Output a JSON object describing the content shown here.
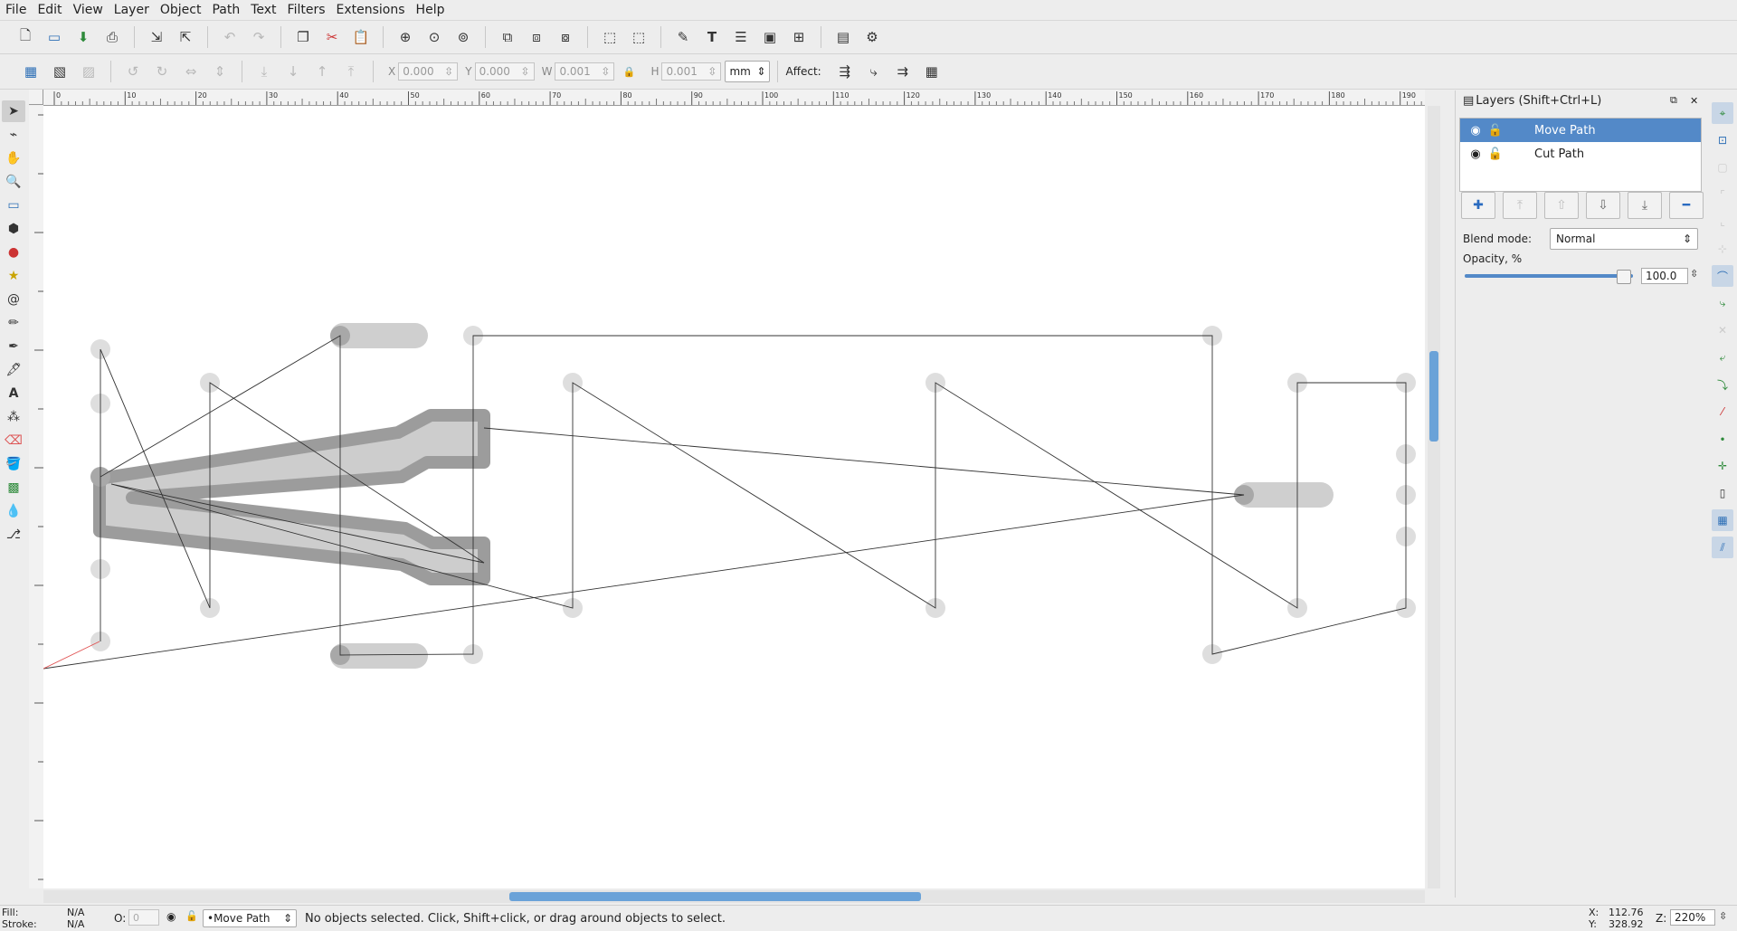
{
  "menu": [
    "File",
    "Edit",
    "View",
    "Layer",
    "Object",
    "Path",
    "Text",
    "Filters",
    "Extensions",
    "Help"
  ],
  "toolbar": {
    "icons": [
      "new-document-icon",
      "open-icon",
      "import-icon",
      "print-icon",
      "import-file-icon",
      "export-icon",
      "undo-icon",
      "redo-icon",
      "duplicate-icon",
      "cut-icon",
      "paste-icon",
      "zoom-selection-icon",
      "zoom-drawing-icon",
      "zoom-page-icon",
      "clone-icon",
      "unlink-clone-icon",
      "select-original-icon",
      "group-icon",
      "ungroup-icon",
      "xml-editor-icon",
      "text-tool-icon",
      "layers-icon",
      "document-properties-icon",
      "align-icon",
      "pdf-import-icon",
      "preferences-icon"
    ]
  },
  "controls": {
    "x_label": "X",
    "x_value": "0.000",
    "y_label": "Y",
    "y_value": "0.000",
    "w_label": "W",
    "w_value": "0.001",
    "h_label": "H",
    "h_value": "0.001",
    "unit": "mm",
    "affect_label": "Affect:"
  },
  "ruler_labels": [
    "0",
    "10",
    "20",
    "30",
    "40",
    "50",
    "60",
    "70",
    "80",
    "90",
    "100",
    "110",
    "120",
    "130",
    "140",
    "150",
    "160",
    "170",
    "180",
    "190"
  ],
  "layers_panel": {
    "title": "Layers (Shift+Ctrl+L)",
    "layers": [
      {
        "name": "Move Path",
        "selected": true
      },
      {
        "name": "Cut Path",
        "selected": false
      }
    ],
    "blend_label": "Blend mode:",
    "blend_value": "Normal",
    "opacity_label": "Opacity, %",
    "opacity_value": "100.0",
    "opacity_fraction": 1.0
  },
  "status": {
    "fill_label": "Fill:",
    "fill_value": "N/A",
    "stroke_label": "Stroke:",
    "stroke_value": "N/A",
    "opacity_label": "O:",
    "opacity_value": "0",
    "current_layer": "•Move Path",
    "message": "No objects selected. Click, Shift+click, or drag around objects to select.",
    "x_label": "X:",
    "x_value": "112.76",
    "y_label": "Y:",
    "y_value": "328.92",
    "zoom_label": "Z:",
    "zoom_value": "220%"
  },
  "colors": {
    "selection": "#5389c8",
    "scroll_thumb": "#6aa2d8",
    "path_stroke": "#333333",
    "cut_shape": "#999999",
    "node_fill": "#d4d4d4"
  }
}
